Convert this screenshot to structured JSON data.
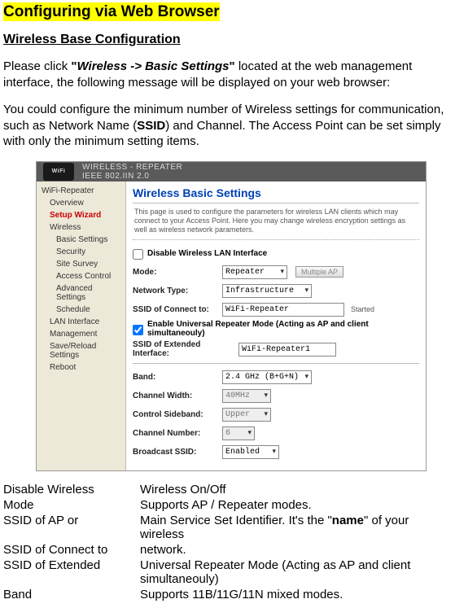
{
  "doc": {
    "title": "Configuring via Web Browser",
    "subtitle": "Wireless Base Configuration",
    "para1_prefix": "Please click ",
    "para1_quote_open": "\"",
    "nav_path": "Wireless -> Basic Settings",
    "para1_quote_close": "\"",
    "para1_suffix": " located at the web management interface, the following message will be displayed on your web browser:",
    "para2_a": "You could configure the minimum number of Wireless settings for communication, such as Network Name (",
    "para2_ssid": "SSID",
    "para2_b": ") and Channel. The Access Point can be set simply with only the minimum setting items."
  },
  "shot": {
    "logo": "WiFi",
    "topbar_a": "WIRELESS - REPEATER",
    "topbar_b": "IEEE 802.IIN 2.0",
    "sidebar": [
      {
        "label": "WiFi-Repeater",
        "indent": false,
        "red": false
      },
      {
        "label": "Overview",
        "indent": true,
        "red": false
      },
      {
        "label": "Setup Wizard",
        "indent": true,
        "red": true
      },
      {
        "label": "Wireless",
        "indent": true,
        "red": false
      },
      {
        "label": "Basic Settings",
        "indent": true,
        "red": false,
        "deep": true
      },
      {
        "label": "Security",
        "indent": true,
        "red": false,
        "deep": true
      },
      {
        "label": "Site Survey",
        "indent": true,
        "red": false,
        "deep": true
      },
      {
        "label": "Access Control",
        "indent": true,
        "red": false,
        "deep": true
      },
      {
        "label": "Advanced Settings",
        "indent": true,
        "red": false,
        "deep": true
      },
      {
        "label": "Schedule",
        "indent": true,
        "red": false,
        "deep": true
      },
      {
        "label": "LAN Interface",
        "indent": true,
        "red": false
      },
      {
        "label": "Management",
        "indent": true,
        "red": false
      },
      {
        "label": "Save/Reload Settings",
        "indent": true,
        "red": false
      },
      {
        "label": "Reboot",
        "indent": true,
        "red": false
      }
    ],
    "panel_title": "Wireless Basic Settings",
    "panel_desc": "This page is used to configure the parameters for wireless LAN clients which may connect to your Access Point. Here you may change wireless encryption settings as well as wireless network parameters.",
    "disable_label": "Disable Wireless LAN Interface",
    "mode_label": "Mode:",
    "mode_value": "Repeater",
    "multiple_ap": "Multiple AP",
    "net_type_label": "Network Type:",
    "net_type_value": "Infrastructure",
    "ssid_connect_label": "SSID of Connect to:",
    "ssid_connect_value": "WiFi-Repeater",
    "started": "Started",
    "enable_ur": "Enable Universal Repeater Mode (Acting as AP and client simultaneouly)",
    "ssid_ext_label": "SSID of Extended Interface:",
    "ssid_ext_value": "WiFi-Repeater1",
    "band_label": "Band:",
    "band_value": "2.4 GHz (B+G+N)",
    "cw_label": "Channel Width:",
    "cw_value": "40MHz",
    "cs_label": "Control Sideband:",
    "cs_value": "Upper",
    "cn_label": "Channel Number:",
    "cn_value": "6",
    "bs_label": "Broadcast SSID:",
    "bs_value": "Enabled"
  },
  "table": {
    "r1k": "Disable Wireless",
    "r1v": "Wireless On/Off",
    "r2k": "Mode",
    "r2v": "Supports  AP / Repeater modes.",
    "r3k": "SSID of AP or",
    "r3va": "Main Service Set Identifier. It's the \"",
    "r3vb": "name",
    "r3vc": "\" of your wireless",
    "r4k": "SSID of Connect to",
    "r4v": "network.",
    "r5k": "SSID of Extended",
    "r5v": "Universal Repeater Mode (Acting as AP and client simultaneouly)",
    "r6k": "Band",
    "r6v": "Supports 11B/11G/11N  mixed modes."
  }
}
